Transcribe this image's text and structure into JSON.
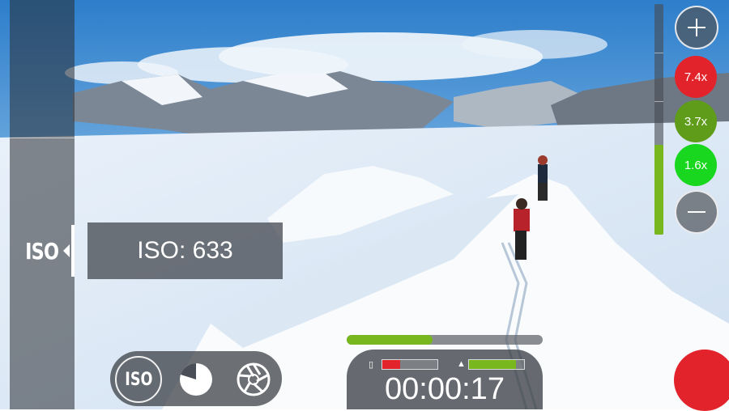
{
  "iso_tab": {
    "label": "ISO"
  },
  "iso_readout": {
    "text": "ISO: 633"
  },
  "zoom": {
    "level_fraction": 0.39,
    "presets": [
      {
        "label": "7.4x",
        "color": "#e3232b"
      },
      {
        "label": "3.7x",
        "color": "#5f9c19"
      },
      {
        "label": "1.6x",
        "color": "#19d61e"
      }
    ]
  },
  "modes": [
    {
      "label": "ISO",
      "icon": "iso-mode-icon"
    },
    {
      "icon": "exposure-pie-icon"
    },
    {
      "icon": "aperture-icon"
    }
  ],
  "recording": {
    "progress_fraction": 0.44,
    "storage_fraction": 0.32,
    "battery_fraction": 0.85,
    "timer": "00:00:17"
  },
  "colors": {
    "accent_green": "#78b81e",
    "record_red": "#e3232b",
    "storage_red": "#e3232b"
  }
}
